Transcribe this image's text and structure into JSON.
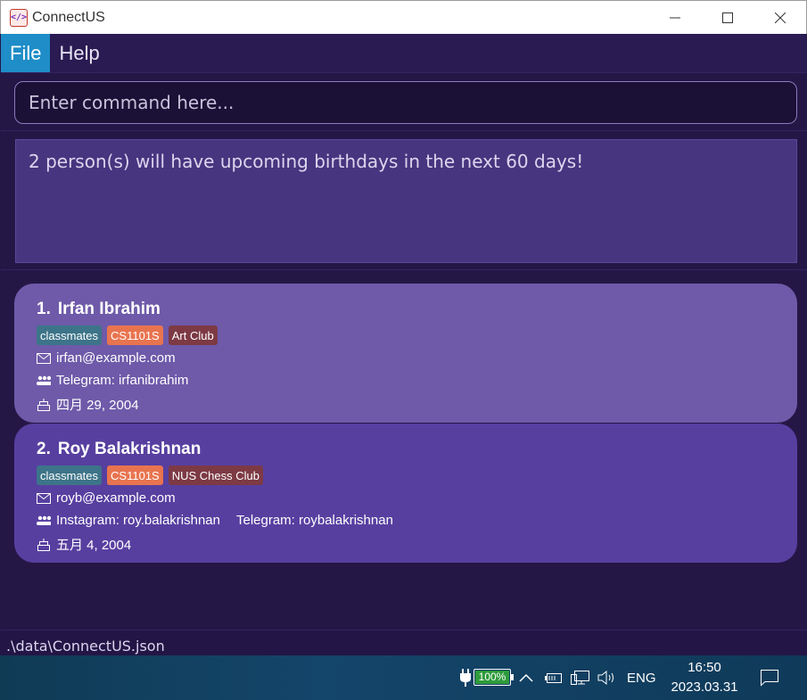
{
  "window": {
    "title": "ConnectUS",
    "icon": "code-icon"
  },
  "menu": {
    "items": [
      {
        "label": "File"
      },
      {
        "label": "Help"
      }
    ]
  },
  "command": {
    "placeholder": "Enter command here...",
    "value": ""
  },
  "result": {
    "text": "2 person(s) will have upcoming birthdays in the next 60 days!"
  },
  "persons": [
    {
      "index": "1.",
      "name": "Irfan Ibrahim",
      "tags": [
        {
          "label": "classmates",
          "color": "#3d7489"
        },
        {
          "label": "CS1101S",
          "color": "#e8744f"
        },
        {
          "label": "Art Club",
          "color": "#7d3a44"
        }
      ],
      "email": "irfan@example.com",
      "socials": [
        "Telegram: irfanibrahim"
      ],
      "birthday": "四月 29, 2004"
    },
    {
      "index": "2.",
      "name": "Roy Balakrishnan",
      "tags": [
        {
          "label": "classmates",
          "color": "#3d7489"
        },
        {
          "label": "CS1101S",
          "color": "#e8744f"
        },
        {
          "label": "NUS Chess Club",
          "color": "#7d3a44"
        }
      ],
      "email": "royb@example.com",
      "socials": [
        "Instagram: roy.balakrishnan",
        "Telegram: roybalakrishnan"
      ],
      "birthday": "五月 4, 2004"
    }
  ],
  "status": {
    "path": ".\\data\\ConnectUS.json"
  },
  "taskbar": {
    "battery_percent": "100%",
    "battery_level": 1.0,
    "language": "ENG",
    "time": "16:50",
    "date": "2023.03.31"
  },
  "colors": {
    "accent": "#1e8dc8",
    "card1": "#6e5aa9",
    "card2": "#573fa0",
    "background": "#241746"
  }
}
